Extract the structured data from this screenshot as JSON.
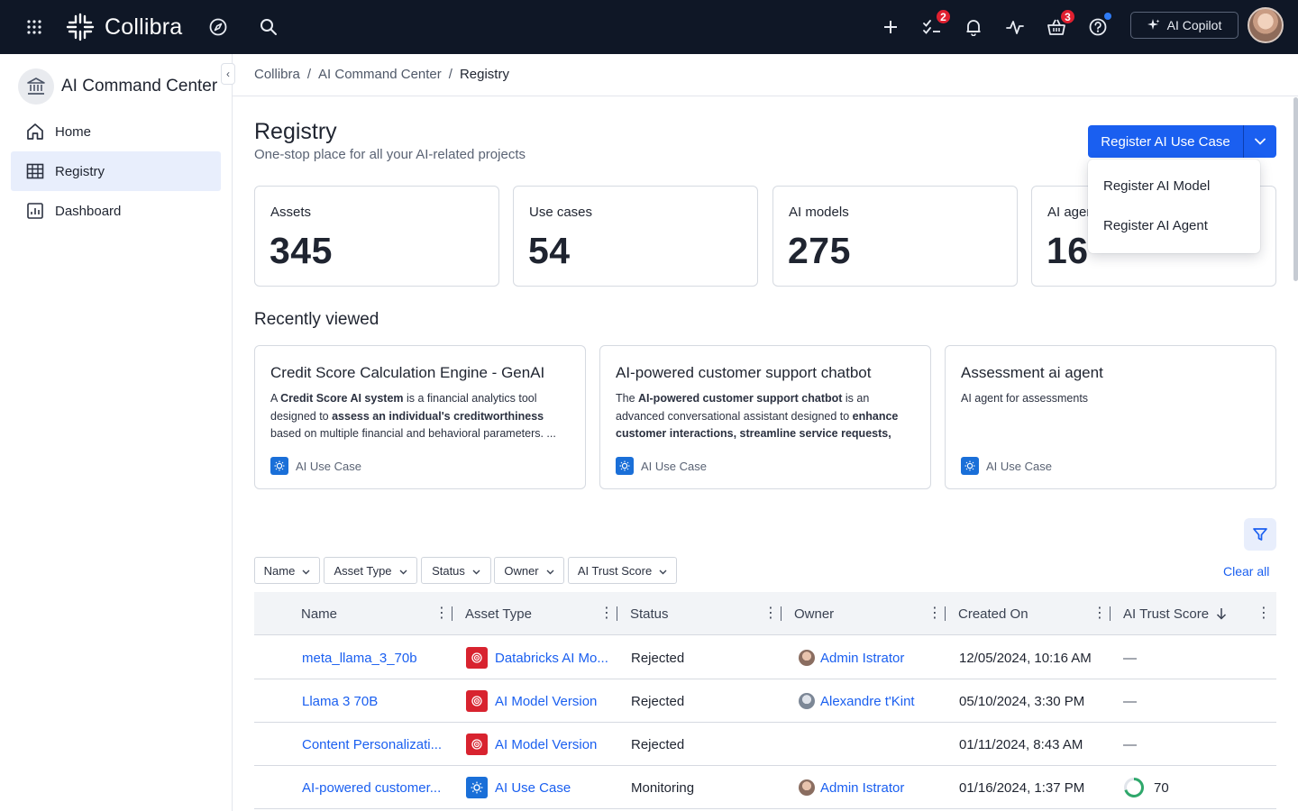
{
  "topbar": {
    "brand": "Collibra",
    "tasks_badge": "2",
    "cart_badge": "3",
    "copilot_label": "AI Copilot"
  },
  "sidebar": {
    "title": "AI Command Center",
    "items": [
      {
        "label": "Home",
        "icon": "home-icon"
      },
      {
        "label": "Registry",
        "icon": "table-icon",
        "active": true
      },
      {
        "label": "Dashboard",
        "icon": "chart-icon"
      }
    ]
  },
  "breadcrumb": [
    "Collibra",
    "AI Command Center",
    "Registry"
  ],
  "header": {
    "title": "Registry",
    "subtitle": "One-stop place for all your AI-related projects",
    "primary_button": "Register AI Use Case",
    "dropdown": [
      "Register AI Model",
      "Register AI Agent"
    ]
  },
  "stats": [
    {
      "label": "Assets",
      "value": "345"
    },
    {
      "label": "Use cases",
      "value": "54"
    },
    {
      "label": "AI models",
      "value": "275"
    },
    {
      "label": "AI agents",
      "value": "16"
    }
  ],
  "recent": {
    "title": "Recently viewed",
    "cards": [
      {
        "title": "Credit Score Calculation Engine - GenAI",
        "desc_parts": [
          "A ",
          "Credit Score AI system",
          " is a financial analytics tool designed to ",
          "assess an individual's creditworthiness",
          " based on multiple financial and behavioral parameters. ..."
        ],
        "type": "AI Use Case"
      },
      {
        "title": "AI-powered customer support chatbot",
        "desc_parts": [
          "The ",
          "AI-powered customer support chatbot",
          " is an advanced conversational assistant designed to ",
          "enhance customer interactions, streamline service requests, and...",
          ""
        ],
        "type": "AI Use Case"
      },
      {
        "title": "Assessment ai agent",
        "desc_parts": [
          "AI agent for assessments",
          "",
          "",
          "",
          ""
        ],
        "type": "AI Use Case"
      }
    ]
  },
  "filters": {
    "chips": [
      "Name",
      "Asset Type",
      "Status",
      "Owner",
      "AI Trust Score"
    ],
    "clear_all": "Clear all"
  },
  "table": {
    "columns": [
      "Name",
      "Asset Type",
      "Status",
      "Owner",
      "Created On",
      "AI Trust Score"
    ],
    "sort": {
      "column": "AI Trust Score",
      "direction": "descending"
    },
    "rows": [
      {
        "name": "meta_llama_3_70b",
        "type": "Databricks AI Mo...",
        "type_icon": "model",
        "status": "Rejected",
        "owner": "Admin Istrator",
        "created": "12/05/2024, 10:16 AM",
        "trust": "—"
      },
      {
        "name": "Llama 3 70B",
        "type": "AI Model Version",
        "type_icon": "model",
        "status": "Rejected",
        "owner": "Alexandre t'Kint",
        "created": "05/10/2024, 3:30 PM",
        "trust": "—"
      },
      {
        "name": "Content Personalizati...",
        "type": "AI Model Version",
        "type_icon": "model",
        "status": "Rejected",
        "owner": "",
        "created": "01/11/2024, 8:43 AM",
        "trust": "—"
      },
      {
        "name": "AI-powered customer...",
        "type": "AI Use Case",
        "type_icon": "usecase",
        "status": "Monitoring",
        "owner": "Admin Istrator",
        "created": "01/16/2024, 1:37 PM",
        "trust": "70",
        "trust_fraction": 0.7
      }
    ]
  },
  "colors": {
    "accent": "#1a5ff0",
    "topbar": "#0f1726",
    "badge": "#e02030",
    "trust_ring": "#2fa86b"
  }
}
